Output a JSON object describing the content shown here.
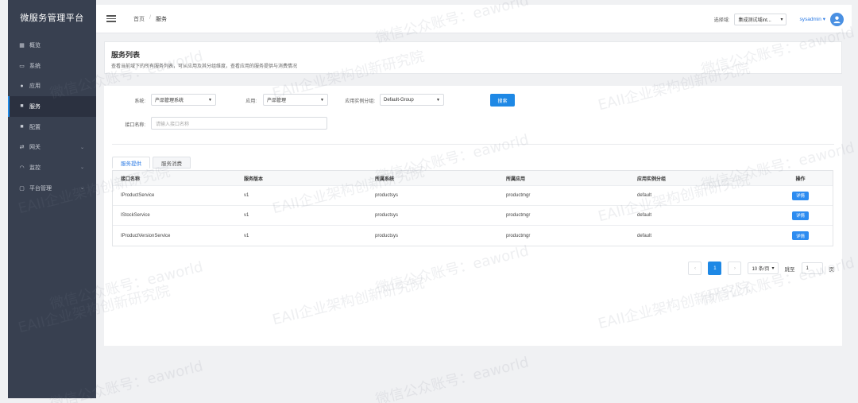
{
  "brand": "微服务管理平台",
  "sidebar": {
    "items": [
      {
        "label": "概览",
        "icon": "grid-icon",
        "expandable": false,
        "active": false
      },
      {
        "label": "系统",
        "icon": "monitor-icon",
        "expandable": false,
        "active": false
      },
      {
        "label": "应用",
        "icon": "circle-icon",
        "expandable": false,
        "active": false
      },
      {
        "label": "服务",
        "icon": "square-icon",
        "expandable": false,
        "active": true
      },
      {
        "label": "配置",
        "icon": "square-icon",
        "expandable": false,
        "active": false
      },
      {
        "label": "网关",
        "icon": "shuffle-icon",
        "expandable": true,
        "active": false
      },
      {
        "label": "监控",
        "icon": "gauge-icon",
        "expandable": true,
        "active": false
      },
      {
        "label": "平台管理",
        "icon": "desktop-icon",
        "expandable": true,
        "active": false
      }
    ]
  },
  "header": {
    "breadcrumb_home": "首页",
    "breadcrumb_sep": "/",
    "breadcrumb_current": "服务",
    "zone_label": "选择域:",
    "zone_value": "集成测试域int...",
    "user": "sysadmin",
    "user_caret": "▾"
  },
  "title_panel": {
    "title": "服务列表",
    "description": "查看当前域下的所有服务列表，可从应用及其分组维度，查看应用的服务提供与消费情况"
  },
  "filters": {
    "system_label": "系统:",
    "system_value": "产品管理系统",
    "app_label": "应用:",
    "app_value": "产品管理",
    "group_label": "应用实例分组:",
    "group_value": "Default-Group",
    "search_button": "搜索",
    "interface_label": "接口名称:",
    "interface_placeholder": "请输入接口名称"
  },
  "tabs": [
    "服务提供",
    "服务消费"
  ],
  "table": {
    "headers": [
      "接口名称",
      "服务版本",
      "所属系统",
      "所属应用",
      "应用实例分组",
      "操作"
    ],
    "rows": [
      {
        "name": "IProductService",
        "version": "v1",
        "system": "productsys",
        "app": "productmgr",
        "group": "default",
        "action": "详情"
      },
      {
        "name": "IStockService",
        "version": "v1",
        "system": "productsys",
        "app": "productmgr",
        "group": "default",
        "action": "详情"
      },
      {
        "name": "IProductVersionService",
        "version": "v1",
        "system": "productsys",
        "app": "productmgr",
        "group": "default",
        "action": "详情"
      }
    ]
  },
  "pagination": {
    "prev": "‹",
    "current": "1",
    "next": "›",
    "page_size": "10 条/页",
    "goto_label": "跳至",
    "goto_value": "1",
    "page_unit": "页"
  },
  "watermark": {
    "line1": "EAII企业架构创新研究院",
    "line2": "微信公众账号：eaworld"
  },
  "colors": {
    "sidebar_bg": "#384050",
    "primary": "#1e88e5",
    "page_bg": "#f0f1f3"
  }
}
